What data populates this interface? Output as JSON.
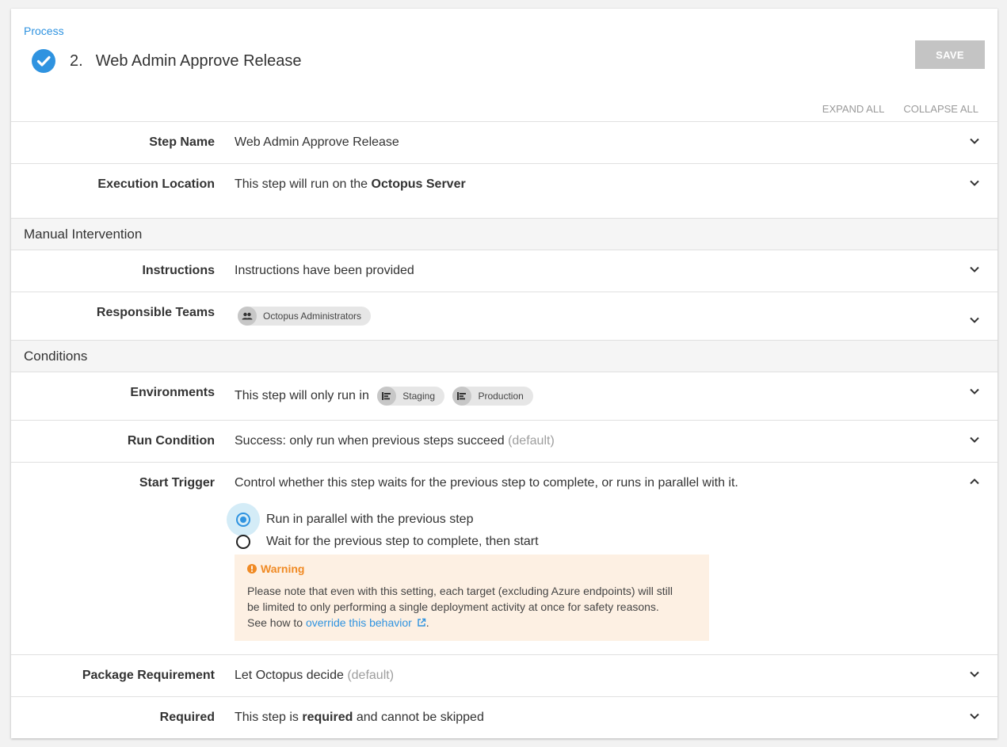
{
  "breadcrumb": "Process",
  "step": {
    "number": "2.",
    "title": "Web Admin Approve Release"
  },
  "toolbar": {
    "save_label": "SAVE",
    "expand_all": "EXPAND ALL",
    "collapse_all": "COLLAPSE ALL"
  },
  "rows": {
    "step_name": {
      "label": "Step Name",
      "value": "Web Admin Approve Release"
    },
    "execution_location": {
      "label": "Execution Location",
      "value_prefix": "This step will run on the ",
      "value_bold": "Octopus Server"
    },
    "instructions": {
      "label": "Instructions",
      "value": "Instructions have been provided"
    },
    "responsible_teams": {
      "label": "Responsible Teams",
      "team": "Octopus Administrators"
    },
    "environments": {
      "label": "Environments",
      "value_prefix": "This step will only run in",
      "envs": [
        "Staging",
        "Production"
      ]
    },
    "run_condition": {
      "label": "Run Condition",
      "value": "Success: only run when previous steps succeed",
      "default": "(default)"
    },
    "start_trigger": {
      "label": "Start Trigger",
      "description": "Control whether this step waits for the previous step to complete, or runs in parallel with it.",
      "options": [
        "Run in parallel with the previous step",
        "Wait for the previous step to complete, then start"
      ],
      "selected": 0
    },
    "package_requirement": {
      "label": "Package Requirement",
      "value": "Let Octopus decide",
      "default": "(default)"
    },
    "required": {
      "label": "Required",
      "value_prefix": "This step is ",
      "value_bold": "required",
      "value_suffix": " and cannot be skipped"
    }
  },
  "sections": {
    "manual_intervention": "Manual Intervention",
    "conditions": "Conditions"
  },
  "warning": {
    "title": "Warning",
    "body_line1": "Please note that even with this setting, each target (excluding Azure endpoints) will still",
    "body_line2": "be limited to only performing a single deployment activity at once for safety reasons.",
    "body_line3_prefix": "See how to ",
    "link_text": "override this behavior",
    "body_line3_suffix": "."
  },
  "colors": {
    "accent": "#2f93e0",
    "warning": "#f08a24",
    "warning_bg": "#fdf0e3",
    "save_disabled": "#c4c4c4"
  },
  "icons": [
    "check-circle-icon",
    "chevron-down-icon",
    "chevron-up-icon",
    "team-icon",
    "environment-icon",
    "alert-icon",
    "external-link-icon"
  ]
}
